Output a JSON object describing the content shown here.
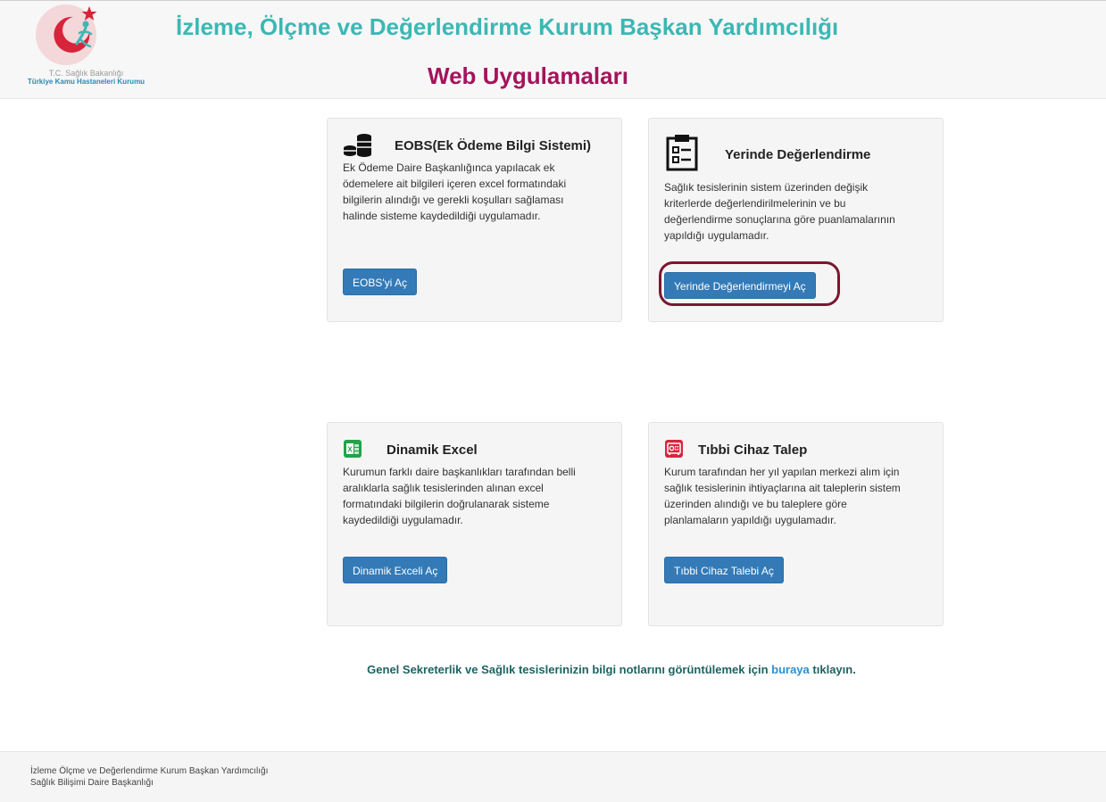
{
  "header": {
    "logo": {
      "line1": "T.C. Sağlık Bakanlığı",
      "line2": "Türkiye Kamu Hastaneleri Kurumu"
    },
    "title": "İzleme, Ölçme ve Değerlendirme Kurum Başkan Yardımcılığı",
    "subtitle": "Web Uygulamaları"
  },
  "cards": [
    {
      "icon": "coins-icon",
      "title": "EOBS(Ek Ödeme Bilgi Sistemi)",
      "desc_lines": [
        "Ek Ödeme Daire Başkanlığınca yapılacak ek",
        "ödemelere ait bilgileri içeren excel formatındaki",
        "bilgilerin alındığı ve gerekli koşulları sağlaması",
        "halinde sisteme kaydedildiği uygulamadır."
      ],
      "button": "EOBS'yi Aç"
    },
    {
      "icon": "clipboard-icon",
      "title": "Yerinde Değerlendirme",
      "desc_lines": [
        "Sağlık tesislerinin sistem üzerinden değişik",
        "kriterlerde değerlendirilmelerinin ve bu",
        "değerlendirme sonuçlarına göre puanlamalarının",
        "yapıldığı uygulamadır."
      ],
      "button": "Yerinde Değerlendirmeyi Aç"
    },
    {
      "icon": "excel-icon",
      "title": "Dinamik Excel",
      "desc_lines": [
        "Kurumun farklı daire başkanlıkları tarafından belli",
        "aralıklarla sağlık tesislerinden alınan excel",
        "formatındaki bilgilerin doğrulanarak sisteme",
        "kaydedildiği uygulamadır."
      ],
      "button": "Dinamik Exceli Aç"
    },
    {
      "icon": "safe-icon",
      "title": "Tıbbi Cihaz Talep",
      "desc_lines": [
        "Kurum tarafından her yıl yapılan merkezi alım için",
        "sağlık tesislerinin ihtiyaçlarına ait taleplerin sistem",
        "üzerinden alındığı ve bu taleplere göre",
        "planlamaların yapıldığı uygulamadır."
      ],
      "button": "Tıbbi Cihaz Talebi Aç"
    }
  ],
  "notice": {
    "before": "Genel Sekreterlik ve Sağlık tesislerinizin bilgi notlarını görüntülemek için",
    "link": "buraya",
    "after": "tıklayın."
  },
  "footer": {
    "line1": "İzleme Ölçme ve Değerlendirme Kurum Başkan Yardımcılığı",
    "line2": "Sağlık Bilişimi Daire Başkanlığı"
  },
  "colors": {
    "title": "#3bb8b4",
    "subtitle": "#a3145b",
    "button": "#337ab7",
    "highlight": "#7a1730",
    "link": "#2a8fd1"
  }
}
